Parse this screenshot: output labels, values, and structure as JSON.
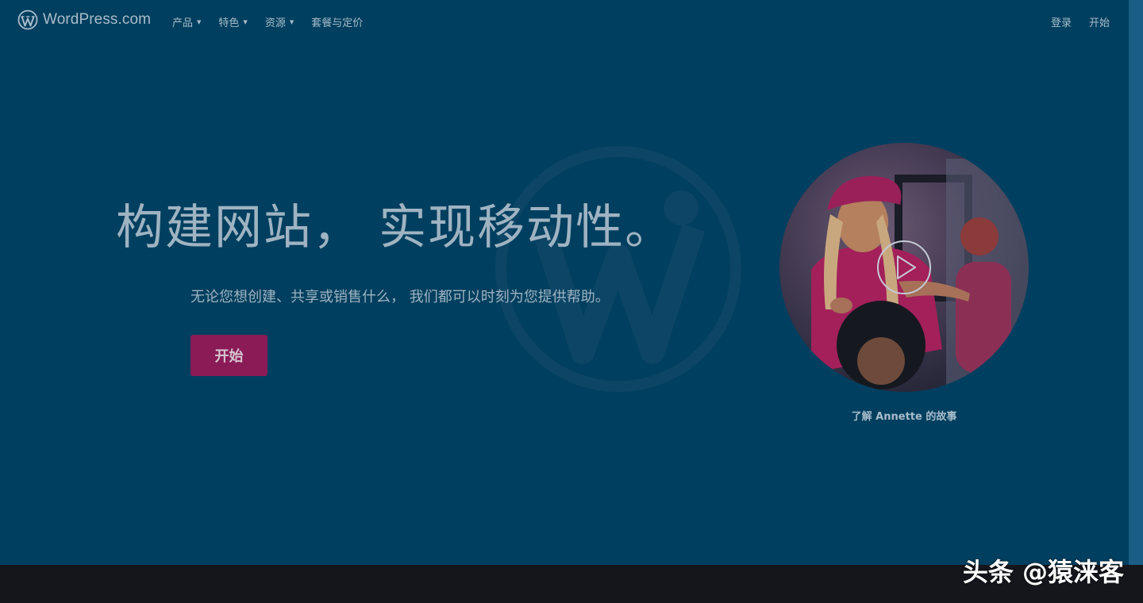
{
  "header": {
    "brand": "WordPress.com",
    "menu": [
      {
        "label": "产品",
        "has_dropdown": true
      },
      {
        "label": "特色",
        "has_dropdown": true
      },
      {
        "label": "资源",
        "has_dropdown": true
      },
      {
        "label": "套餐与定价",
        "has_dropdown": false
      }
    ],
    "login_label": "登录",
    "start_label": "开始"
  },
  "hero": {
    "title": "构建网站， 实现移动性。",
    "subtitle": "无论您想创建、共享或销售什么， 我们都可以时刻为您提供帮助。",
    "cta_label": "开始"
  },
  "video": {
    "caption": "了解 Annette 的故事"
  },
  "watermark": {
    "text": "头条 @猿涞客"
  },
  "icons": {
    "brand": "wordpress-logo-icon",
    "background": "wordpress-watermark-icon",
    "play": "play-icon",
    "caret": "caret-down-icon"
  },
  "colors": {
    "background": "#003f5f",
    "cta": "#8a1b57",
    "text": "#a9bccb",
    "bottom_band": "#14161c"
  }
}
